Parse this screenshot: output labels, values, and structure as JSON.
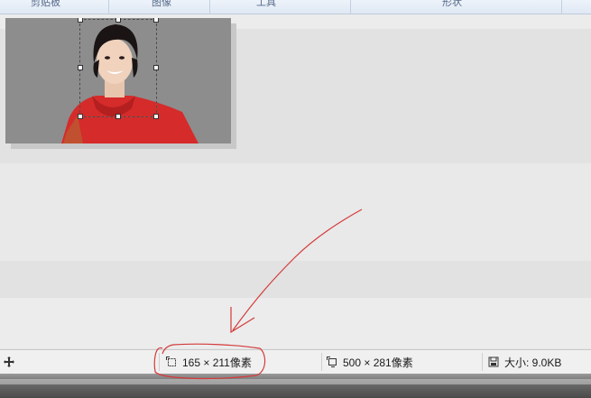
{
  "ribbon": {
    "groups": [
      "剪贴板",
      "图像",
      "工具",
      "形状"
    ]
  },
  "statusbar": {
    "selection_size": "165 × 211像素",
    "image_size": "500 × 281像素",
    "file_size": "大小: 9.0KB"
  },
  "colors": {
    "annotation": "#d43a3a",
    "accent": "#2f5597"
  }
}
